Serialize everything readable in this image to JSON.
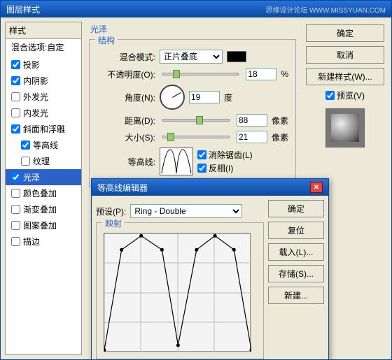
{
  "main": {
    "title": "图层样式",
    "watermark": "思缘设计论坛  WWW.MISSYUAN.COM",
    "sidebar": {
      "header": "样式",
      "blend_label": "混合选项:自定",
      "items": [
        {
          "label": "投影",
          "checked": true
        },
        {
          "label": "内阴影",
          "checked": true
        },
        {
          "label": "外发光",
          "checked": false
        },
        {
          "label": "内发光",
          "checked": false
        },
        {
          "label": "斜面和浮雕",
          "checked": true
        },
        {
          "label": "等高线",
          "checked": true,
          "indent": true
        },
        {
          "label": "纹理",
          "checked": false,
          "indent": true
        },
        {
          "label": "光泽",
          "checked": true,
          "selected": true
        },
        {
          "label": "颜色叠加",
          "checked": false
        },
        {
          "label": "渐变叠加",
          "checked": false
        },
        {
          "label": "图案叠加",
          "checked": false
        },
        {
          "label": "描边",
          "checked": false
        }
      ]
    },
    "panel": {
      "title": "光泽",
      "struct_title": "结构",
      "blend_mode_label": "混合模式:",
      "blend_mode_value": "正片叠底",
      "opacity_label": "不透明度(O):",
      "opacity_value": "18",
      "opacity_unit": "%",
      "angle_label": "角度(N):",
      "angle_value": "19",
      "angle_unit": "度",
      "distance_label": "距离(D):",
      "distance_value": "88",
      "distance_unit": "像素",
      "size_label": "大小(S):",
      "size_value": "21",
      "size_unit": "像素",
      "contour_label": "等高线:",
      "aa_label": "消除锯齿(L)",
      "invert_label": "反相(I)"
    },
    "buttons": {
      "ok": "确定",
      "cancel": "取消",
      "newstyle": "新建样式(W)...",
      "preview": "预览(V)"
    }
  },
  "sub": {
    "title": "等高线编辑器",
    "preset_label": "预设(P):",
    "preset_value": "Ring - Double",
    "map_title": "映射",
    "buttons": {
      "ok": "确定",
      "reset": "复位",
      "load": "载入(L)...",
      "save": "存储(S)...",
      "new": "新建..."
    }
  },
  "chart_data": {
    "type": "line",
    "title": "Ring - Double contour curve",
    "xlim": [
      0,
      255
    ],
    "ylim": [
      0,
      255
    ],
    "points": [
      {
        "x": 0,
        "y": 5
      },
      {
        "x": 30,
        "y": 220
      },
      {
        "x": 64,
        "y": 250
      },
      {
        "x": 100,
        "y": 220
      },
      {
        "x": 128,
        "y": 15
      },
      {
        "x": 160,
        "y": 220
      },
      {
        "x": 192,
        "y": 250
      },
      {
        "x": 225,
        "y": 220
      },
      {
        "x": 255,
        "y": 5
      }
    ]
  }
}
